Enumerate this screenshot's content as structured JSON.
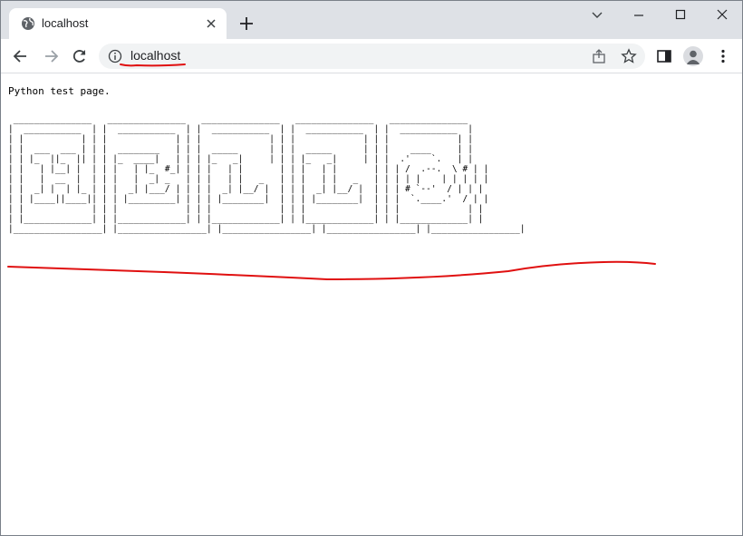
{
  "browser": {
    "tab": {
      "title": "localhost",
      "icon": "globe-icon"
    },
    "new_tab_icon": "plus-icon",
    "window_controls": [
      "chevron-down-icon",
      "minimize-icon",
      "maximize-icon",
      "close-icon"
    ],
    "nav": [
      "back-arrow-icon",
      "forward-arrow-icon",
      "reload-icon"
    ],
    "address": {
      "url": "localhost",
      "info_icon": "info-icon"
    },
    "toolbar_icons": [
      "share-icon",
      "star-icon",
      "side-panel-icon",
      "profile-icon",
      "menu-icon"
    ]
  },
  "page": {
    "text": "Python test page.",
    "ascii_art": " _______________   _______________   _______________   _______________   _______________\n|  ___________  | |  ___________  | |  ___________  | |  ___________  | |  ___________  |\n| |           | | |             | | |             | | |             | | |             | |\n| |  ___  ___ | | |  ________   | | |  _____      | | |  _____      | | |    ____     | |\n| | |_  ||_  || | | |_  ____|   | | | |_   _|     | | | |_   _|     | | |  .'    `.   | |\n| |   | |__| |  | | |   | |_  #_| | | |   | |       | | |   | |       | | | /  .--.  \\ # | |\n| |   |  __  |  | | |   |  _| _   | | |   | |   _   | | |   | |   _   | | | | |    | | | | |\n| |  _| |  | |_ | | |  _| |___/ | | | |  _| |__/ |  | | |  _| |__/ |  | | | # `--'  / | | |\n| | |____||____|| | | |_________| | | | |________|  | | | |________|  | | |  `.____.'  / | |\n| |             | | |             | | |             | | |             | | |             | |\n| |_____________| | |_____________| | |_____________| | |_____________| | |_____________| |\n|_________________| |_________________| |_________________| |_________________| |_________________|"
  },
  "colors": {
    "tabstrip": "#dee1e6",
    "annotation": "#e01010"
  }
}
